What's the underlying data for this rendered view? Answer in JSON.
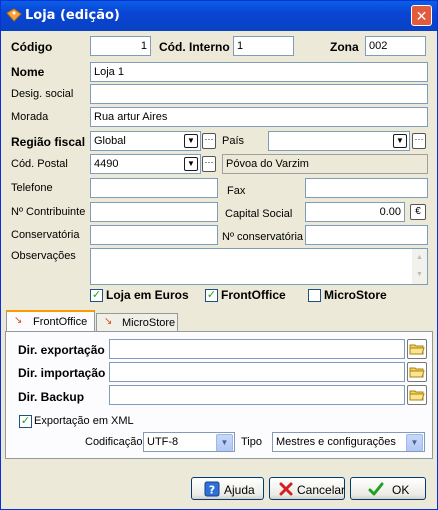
{
  "window": {
    "title": "Loja (edição)",
    "close_label": "✕"
  },
  "labels": {
    "codigo": "Código",
    "cod_interno": "Cód. Interno",
    "zona": "Zona",
    "nome": "Nome",
    "desig_social": "Desig. social",
    "morada": "Morada",
    "regiao_fiscal": "Região fiscal",
    "pais": "País",
    "cod_postal": "Cód. Postal",
    "telefone": "Telefone",
    "fax": "Fax",
    "contribuinte": "Nº Contribuinte",
    "capital_social": "Capital Social",
    "conservatoria": "Conservatória",
    "n_conservatoria": "Nº conservatória",
    "observacoes": "Observações"
  },
  "fields": {
    "codigo": "1",
    "cod_interno": "1",
    "zona": "002",
    "nome": "Loja 1",
    "desig_social": "",
    "morada": "Rua artur Aires",
    "regiao_fiscal": "Global",
    "pais": "",
    "cod_postal": "4490",
    "localidade": "Póvoa do Varzim",
    "telefone": "",
    "fax": "",
    "contribuinte": "",
    "capital_social": "0.00",
    "currency_symbol": "€",
    "conservatoria": "",
    "n_conservatoria": "",
    "observacoes": ""
  },
  "checks": {
    "loja_em_euros": {
      "label": "Loja em Euros",
      "checked": true
    },
    "frontoffice": {
      "label": "FrontOffice",
      "checked": true
    },
    "microstore": {
      "label": "MicroStore",
      "checked": false
    }
  },
  "tabs": [
    {
      "label": "FrontOffice",
      "active": true
    },
    {
      "label": "MicroStore",
      "active": false
    }
  ],
  "frontoffice": {
    "dir_exportacao_label": "Dir. exportação",
    "dir_importacao_label": "Dir. importação",
    "dir_backup_label": "Dir. Backup",
    "dir_exportacao": "",
    "dir_importacao": "",
    "dir_backup": "",
    "xml_label": "Exportação em XML",
    "xml_checked": true,
    "codificacao_label": "Codificação",
    "codificacao": "UTF-8",
    "tipo_label": "Tipo",
    "tipo": "Mestres e configurações"
  },
  "buttons": {
    "ajuda": "Ajuda",
    "cancelar": "Cancelar",
    "ok": "OK"
  },
  "colors": {
    "title_bar": "#0a4fd8",
    "ok_check": "#21a121",
    "cancel_x": "#d22020",
    "tab_highlight": "#ff9900"
  }
}
